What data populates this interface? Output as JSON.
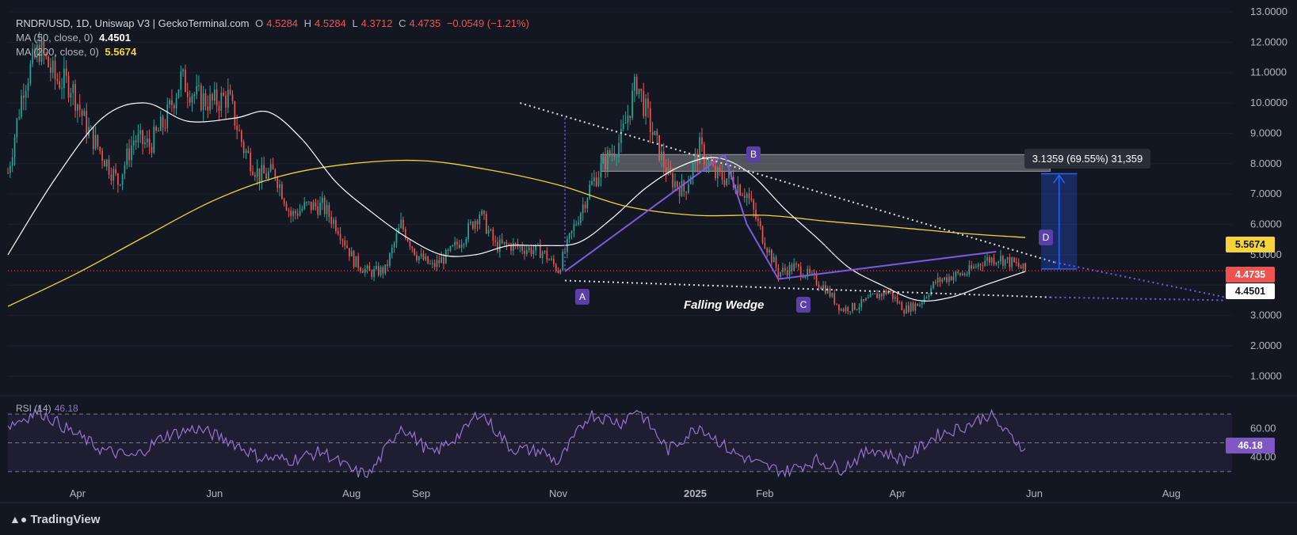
{
  "header": {
    "symbol_line": "RNDR/USD, 1D, Uniswap V3 | GeckoTerminal.com",
    "o_label": "O",
    "o_value": "4.5284",
    "h_label": "H",
    "h_value": "4.5284",
    "l_label": "L",
    "l_value": "4.3712",
    "c_label": "C",
    "c_value": "4.4735",
    "change": "−0.0549 (−1.21%)",
    "ma50_label": "MA (50, close, 0)",
    "ma50_value": "4.4501",
    "ma200_label": "MA (200, close, 0)",
    "ma200_value": "5.5674",
    "rsi_label": "RSI (14)",
    "rsi_value": "46.18"
  },
  "price_tags": {
    "ma200": "5.5674",
    "last": "4.4735",
    "ma50": "4.4501",
    "rsi": "46.18"
  },
  "annotations": {
    "measure": "3.1359 (69.55%) 31,359",
    "pattern": "Falling Wedge",
    "points": [
      "A",
      "B",
      "C",
      "D"
    ]
  },
  "brand": "TradingView",
  "colors": {
    "background": "#131722",
    "up": "#26a69a",
    "down": "#ef5350",
    "ma50": "#ffffff",
    "ma200": "#f5d33a",
    "rsi": "#9575cd",
    "pattern": "#7b5ce0",
    "measure": "#2962ff"
  },
  "chart_data": {
    "type": "candlestick",
    "title": "RNDR/USD, 1D, Uniswap V3",
    "ylim": [
      0.8,
      13.0
    ],
    "y_ticks": [
      "13.0000",
      "12.0000",
      "11.0000",
      "10.0000",
      "9.0000",
      "8.0000",
      "7.0000",
      "6.0000",
      "5.0000",
      "3.0000",
      "2.0000",
      "1.0000"
    ],
    "x_ticks": [
      "Apr",
      "Jun",
      "Aug",
      "Sep",
      "Nov",
      "2025",
      "Feb",
      "Apr",
      "Jun",
      "Aug"
    ],
    "x_range": [
      "2024-03-01",
      "2025-08-28"
    ],
    "price_path": [
      {
        "date": "2024-03-01",
        "close": 7.7
      },
      {
        "date": "2024-03-08",
        "close": 10.6
      },
      {
        "date": "2024-03-15",
        "close": 11.8
      },
      {
        "date": "2024-03-22",
        "close": 10.8
      },
      {
        "date": "2024-03-29",
        "close": 10.6
      },
      {
        "date": "2024-04-05",
        "close": 9.2
      },
      {
        "date": "2024-04-12",
        "close": 8.3
      },
      {
        "date": "2024-04-19",
        "close": 7.4
      },
      {
        "date": "2024-04-26",
        "close": 8.8
      },
      {
        "date": "2024-05-03",
        "close": 8.6
      },
      {
        "date": "2024-05-10",
        "close": 9.4
      },
      {
        "date": "2024-05-17",
        "close": 10.8
      },
      {
        "date": "2024-05-24",
        "close": 10.2
      },
      {
        "date": "2024-05-31",
        "close": 10.0
      },
      {
        "date": "2024-06-07",
        "close": 10.2
      },
      {
        "date": "2024-06-14",
        "close": 8.5
      },
      {
        "date": "2024-06-21",
        "close": 7.6
      },
      {
        "date": "2024-06-28",
        "close": 7.7
      },
      {
        "date": "2024-07-05",
        "close": 6.3
      },
      {
        "date": "2024-07-12",
        "close": 6.6
      },
      {
        "date": "2024-07-19",
        "close": 6.6
      },
      {
        "date": "2024-07-26",
        "close": 5.9
      },
      {
        "date": "2024-08-02",
        "close": 4.8
      },
      {
        "date": "2024-08-09",
        "close": 4.4
      },
      {
        "date": "2024-08-16",
        "close": 4.5
      },
      {
        "date": "2024-08-23",
        "close": 6.0
      },
      {
        "date": "2024-08-30",
        "close": 5.0
      },
      {
        "date": "2024-09-06",
        "close": 4.6
      },
      {
        "date": "2024-09-13",
        "close": 5.0
      },
      {
        "date": "2024-09-20",
        "close": 5.6
      },
      {
        "date": "2024-09-27",
        "close": 6.4
      },
      {
        "date": "2024-10-04",
        "close": 5.3
      },
      {
        "date": "2024-10-11",
        "close": 5.3
      },
      {
        "date": "2024-10-18",
        "close": 5.2
      },
      {
        "date": "2024-10-25",
        "close": 5.1
      },
      {
        "date": "2024-11-01",
        "close": 4.5
      },
      {
        "date": "2024-11-08",
        "close": 5.9
      },
      {
        "date": "2024-11-15",
        "close": 7.2
      },
      {
        "date": "2024-11-22",
        "close": 8.1
      },
      {
        "date": "2024-11-29",
        "close": 8.8
      },
      {
        "date": "2024-12-06",
        "close": 10.7
      },
      {
        "date": "2024-12-13",
        "close": 9.0
      },
      {
        "date": "2024-12-20",
        "close": 7.6
      },
      {
        "date": "2024-12-27",
        "close": 7.1
      },
      {
        "date": "2025-01-03",
        "close": 8.5
      },
      {
        "date": "2025-01-10",
        "close": 7.6
      },
      {
        "date": "2025-01-17",
        "close": 7.5
      },
      {
        "date": "2025-01-24",
        "close": 7.0
      },
      {
        "date": "2025-01-31",
        "close": 5.6
      },
      {
        "date": "2025-02-07",
        "close": 4.4
      },
      {
        "date": "2025-02-14",
        "close": 4.6
      },
      {
        "date": "2025-02-21",
        "close": 4.3
      },
      {
        "date": "2025-02-28",
        "close": 3.9
      },
      {
        "date": "2025-03-07",
        "close": 3.2
      },
      {
        "date": "2025-03-14",
        "close": 3.3
      },
      {
        "date": "2025-03-21",
        "close": 3.6
      },
      {
        "date": "2025-03-28",
        "close": 3.8
      },
      {
        "date": "2025-04-04",
        "close": 3.2
      },
      {
        "date": "2025-04-11",
        "close": 3.4
      },
      {
        "date": "2025-04-18",
        "close": 4.1
      },
      {
        "date": "2025-04-25",
        "close": 4.3
      },
      {
        "date": "2025-05-02",
        "close": 4.4
      },
      {
        "date": "2025-05-09",
        "close": 4.8
      },
      {
        "date": "2025-05-16",
        "close": 4.9
      },
      {
        "date": "2025-05-23",
        "close": 4.7
      },
      {
        "date": "2025-05-28",
        "close": 4.4735
      }
    ],
    "ma50": [
      {
        "date": "2024-03-01",
        "value": 5.0
      },
      {
        "date": "2024-03-22",
        "value": 7.5
      },
      {
        "date": "2024-04-12",
        "value": 9.5
      },
      {
        "date": "2024-05-01",
        "value": 10.0
      },
      {
        "date": "2024-05-20",
        "value": 9.4
      },
      {
        "date": "2024-06-10",
        "value": 9.5
      },
      {
        "date": "2024-06-25",
        "value": 9.7
      },
      {
        "date": "2024-07-10",
        "value": 8.8
      },
      {
        "date": "2024-07-25",
        "value": 7.4
      },
      {
        "date": "2024-08-10",
        "value": 6.4
      },
      {
        "date": "2024-08-25",
        "value": 5.6
      },
      {
        "date": "2024-09-10",
        "value": 5.0
      },
      {
        "date": "2024-09-25",
        "value": 5.0
      },
      {
        "date": "2024-10-10",
        "value": 5.3
      },
      {
        "date": "2024-10-25",
        "value": 5.3
      },
      {
        "date": "2024-11-10",
        "value": 5.4
      },
      {
        "date": "2024-11-25",
        "value": 6.2
      },
      {
        "date": "2024-12-10",
        "value": 7.2
      },
      {
        "date": "2024-12-25",
        "value": 7.9
      },
      {
        "date": "2025-01-10",
        "value": 8.2
      },
      {
        "date": "2025-01-25",
        "value": 7.7
      },
      {
        "date": "2025-02-10",
        "value": 6.5
      },
      {
        "date": "2025-02-25",
        "value": 5.5
      },
      {
        "date": "2025-03-10",
        "value": 4.6
      },
      {
        "date": "2025-03-25",
        "value": 4.0
      },
      {
        "date": "2025-04-10",
        "value": 3.5
      },
      {
        "date": "2025-04-25",
        "value": 3.6
      },
      {
        "date": "2025-05-10",
        "value": 4.0
      },
      {
        "date": "2025-05-28",
        "value": 4.4501
      }
    ],
    "ma200": [
      {
        "date": "2024-03-01",
        "value": 3.3
      },
      {
        "date": "2024-04-01",
        "value": 4.4
      },
      {
        "date": "2024-05-01",
        "value": 5.6
      },
      {
        "date": "2024-06-01",
        "value": 6.8
      },
      {
        "date": "2024-07-01",
        "value": 7.6
      },
      {
        "date": "2024-08-01",
        "value": 8.0
      },
      {
        "date": "2024-09-01",
        "value": 8.1
      },
      {
        "date": "2024-10-01",
        "value": 7.8
      },
      {
        "date": "2024-11-01",
        "value": 7.3
      },
      {
        "date": "2024-12-01",
        "value": 6.6
      },
      {
        "date": "2025-01-01",
        "value": 6.3
      },
      {
        "date": "2025-02-01",
        "value": 6.3
      },
      {
        "date": "2025-03-01",
        "value": 6.1
      },
      {
        "date": "2025-04-01",
        "value": 5.9
      },
      {
        "date": "2025-05-01",
        "value": 5.7
      },
      {
        "date": "2025-05-28",
        "value": 5.5674
      }
    ],
    "rsi": {
      "ticks": [
        "60.00",
        "40.00"
      ],
      "bands": [
        70,
        50,
        30
      ],
      "ylim": [
        25,
        80
      ],
      "values": [
        {
          "date": "2024-03-01",
          "value": 62
        },
        {
          "date": "2024-03-15",
          "value": 72
        },
        {
          "date": "2024-03-29",
          "value": 58
        },
        {
          "date": "2024-04-12",
          "value": 45
        },
        {
          "date": "2024-04-26",
          "value": 40
        },
        {
          "date": "2024-05-10",
          "value": 55
        },
        {
          "date": "2024-05-24",
          "value": 60
        },
        {
          "date": "2024-06-07",
          "value": 52
        },
        {
          "date": "2024-06-21",
          "value": 40
        },
        {
          "date": "2024-07-05",
          "value": 38
        },
        {
          "date": "2024-07-19",
          "value": 44
        },
        {
          "date": "2024-08-02",
          "value": 30
        },
        {
          "date": "2024-08-09",
          "value": 28
        },
        {
          "date": "2024-08-23",
          "value": 62
        },
        {
          "date": "2024-09-06",
          "value": 42
        },
        {
          "date": "2024-09-20",
          "value": 58
        },
        {
          "date": "2024-09-27",
          "value": 72
        },
        {
          "date": "2024-10-11",
          "value": 46
        },
        {
          "date": "2024-10-25",
          "value": 44
        },
        {
          "date": "2024-11-01",
          "value": 36
        },
        {
          "date": "2024-11-15",
          "value": 70
        },
        {
          "date": "2024-11-29",
          "value": 64
        },
        {
          "date": "2024-12-06",
          "value": 74
        },
        {
          "date": "2024-12-20",
          "value": 45
        },
        {
          "date": "2025-01-03",
          "value": 62
        },
        {
          "date": "2025-01-17",
          "value": 44
        },
        {
          "date": "2025-01-31",
          "value": 34
        },
        {
          "date": "2025-02-10",
          "value": 30
        },
        {
          "date": "2025-02-24",
          "value": 38
        },
        {
          "date": "2025-03-07",
          "value": 32
        },
        {
          "date": "2025-03-21",
          "value": 46
        },
        {
          "date": "2025-04-04",
          "value": 38
        },
        {
          "date": "2025-04-18",
          "value": 55
        },
        {
          "date": "2025-05-02",
          "value": 62
        },
        {
          "date": "2025-05-12",
          "value": 70
        },
        {
          "date": "2025-05-20",
          "value": 56
        },
        {
          "date": "2025-05-28",
          "value": 46.18
        }
      ]
    },
    "pattern_points": [
      {
        "label": "A",
        "date": "2024-11-04",
        "value": 4.45
      },
      {
        "label": "B",
        "date": "2025-01-14",
        "value": 8.3
      },
      {
        "label": "C",
        "date": "2025-02-07",
        "value": 4.2
      },
      {
        "label": "D",
        "date": "2025-05-15",
        "value": 5.1
      }
    ],
    "measure": {
      "from": 4.53,
      "to": 7.67,
      "change": 3.1359,
      "percent": 69.55
    },
    "resistance_zone": {
      "from": 7.75,
      "to": 8.3
    },
    "last_price": 4.4735
  }
}
